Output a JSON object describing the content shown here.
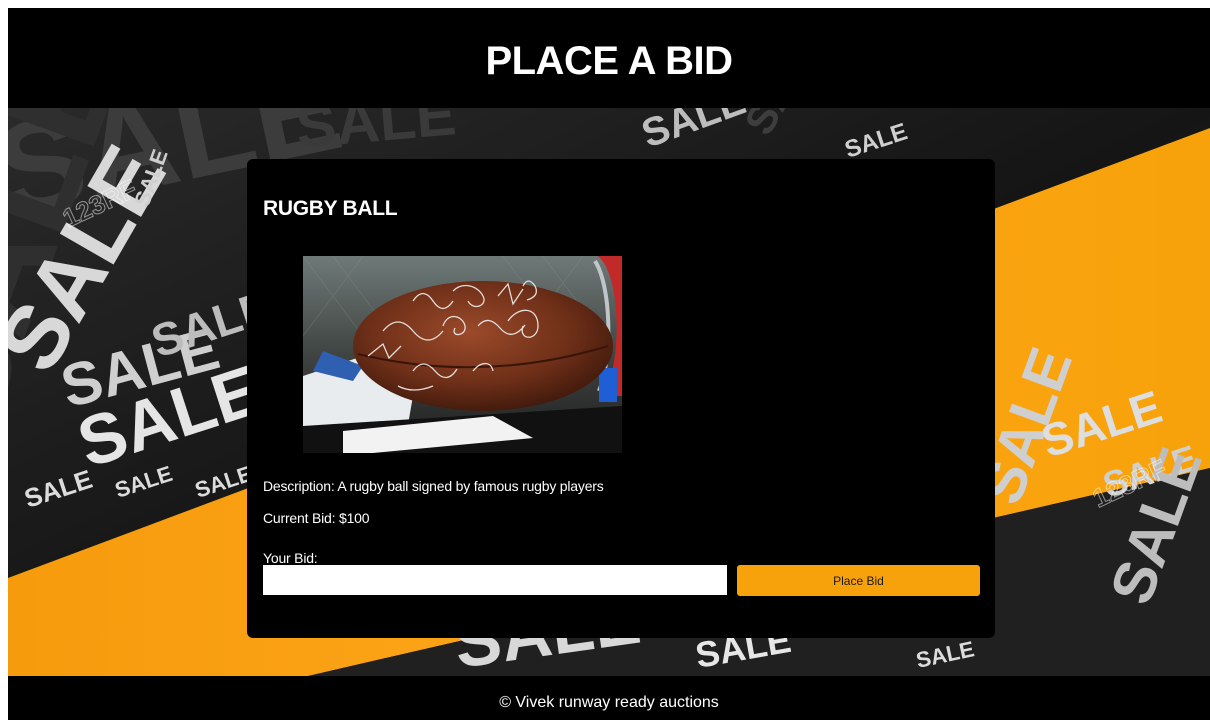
{
  "header": {
    "title": "PLACE A BID"
  },
  "banner": {
    "sale_word": "SALE",
    "watermark_text": "123RF",
    "accent_color": "#f7a20a"
  },
  "item": {
    "name": "RUGBY BALL",
    "image_alt": "Signed rugby ball",
    "description_text": "Description: A rugby ball signed by famous rugby players",
    "current_bid_text": "Current Bid: $100"
  },
  "bid_form": {
    "label": "Your Bid:",
    "input_value": "",
    "button_label": "Place Bid"
  },
  "footer": {
    "copyright": "© Vivek runway ready auctions"
  },
  "colors": {
    "page_background": "#000000",
    "card_background": "#000000",
    "button_background": "#f7a20a",
    "text": "#ffffff"
  }
}
